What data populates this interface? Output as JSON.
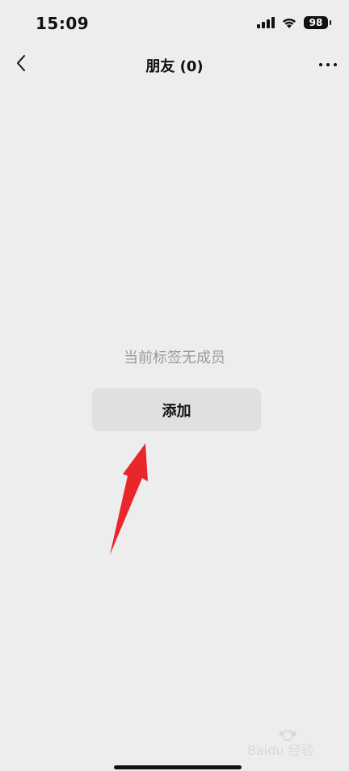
{
  "status_bar": {
    "time": "15:09",
    "battery": "98",
    "icons": [
      "signal-icon",
      "wifi-icon",
      "battery-icon"
    ]
  },
  "nav": {
    "title": "朋友 (0)",
    "back_icon": "chevron-left-icon",
    "more_icon": "more-dots-icon"
  },
  "content": {
    "empty_message": "当前标签无成员",
    "add_label": "添加"
  },
  "annotation": {
    "arrow_color": "#e8262c"
  },
  "watermark": {
    "text": "Baidu 经验"
  }
}
